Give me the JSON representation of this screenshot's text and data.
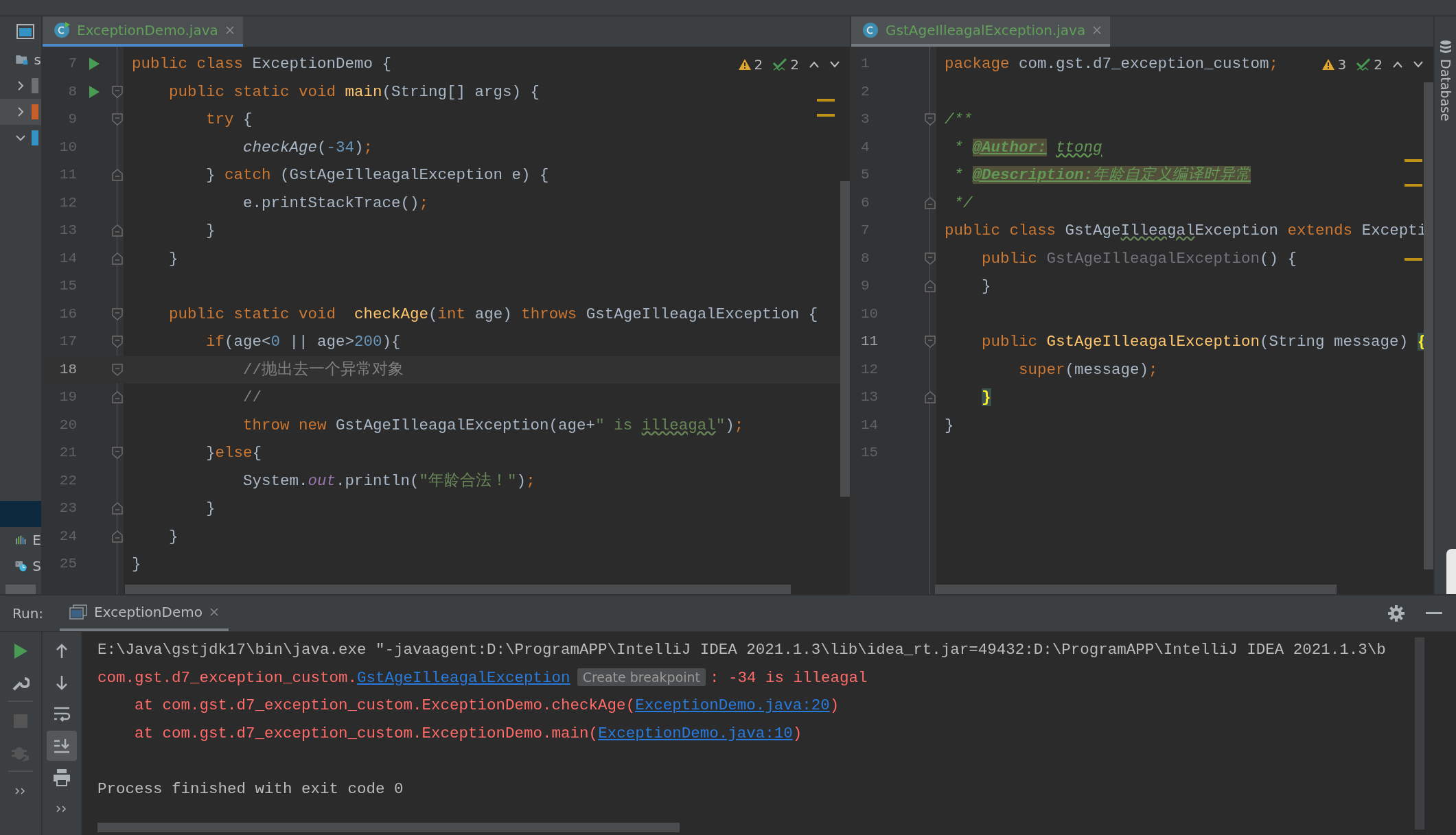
{
  "project_strip": {
    "items": [
      {
        "kind": "folder",
        "label": "s",
        "selected": false
      },
      {
        "kind": "collapsed",
        "color": "#6e7174",
        "selected": false
      },
      {
        "kind": "collapsed",
        "color": "#c75f2b",
        "selected": true
      },
      {
        "kind": "expanded",
        "color": "#3592c4",
        "selected": false
      },
      {
        "kind": "blank",
        "selected": false
      },
      {
        "kind": "chart",
        "label": "E",
        "selected": false
      },
      {
        "kind": "services",
        "label": "S",
        "selected": false
      }
    ]
  },
  "left_editor": {
    "focused": true,
    "tab": {
      "label": "ExceptionDemo.java",
      "selected": true
    },
    "inspections": {
      "warnings": "2",
      "weak_warnings": "2"
    },
    "lines": [
      {
        "number": "7",
        "current": false,
        "run": true,
        "fold_marker": false,
        "tokens": [
          {
            "kind": "kw",
            "text": "public class "
          },
          {
            "kind": "pl",
            "text": "ExceptionDemo {"
          }
        ]
      },
      {
        "number": "8",
        "current": false,
        "run": true,
        "fold_marker": true,
        "fold_end": false,
        "tokens": [
          {
            "kind": "kw",
            "text": "    public static void "
          },
          {
            "kind": "decl",
            "text": "main"
          },
          {
            "kind": "pl",
            "text": "(String[] args) {"
          }
        ]
      },
      {
        "number": "9",
        "current": false,
        "run": false,
        "fold_marker": true,
        "fold_end": false,
        "tokens": [
          {
            "kind": "kw",
            "text": "        try "
          },
          {
            "kind": "pl",
            "text": "{"
          }
        ]
      },
      {
        "number": "10",
        "current": false,
        "run": false,
        "fold_marker": false,
        "tokens": [
          {
            "kind": "it",
            "text": "            checkAge"
          },
          {
            "kind": "pl",
            "text": "("
          },
          {
            "kind": "num",
            "text": "-34"
          },
          {
            "kind": "pl",
            "text": ")"
          },
          {
            "kind": "kw",
            "text": ";"
          }
        ]
      },
      {
        "number": "11",
        "current": false,
        "run": false,
        "fold_marker": true,
        "fold_end": true,
        "tokens": [
          {
            "kind": "pl",
            "text": "        } "
          },
          {
            "kind": "kw",
            "text": "catch "
          },
          {
            "kind": "pl",
            "text": "(GstAgeIlleagalException e) {"
          }
        ]
      },
      {
        "number": "12",
        "current": false,
        "run": false,
        "fold_marker": false,
        "tokens": [
          {
            "kind": "pl",
            "text": "            e.printStackTrace()"
          },
          {
            "kind": "kw",
            "text": ";"
          }
        ]
      },
      {
        "number": "13",
        "current": false,
        "run": false,
        "fold_marker": true,
        "fold_end": true,
        "tokens": [
          {
            "kind": "pl",
            "text": "        }"
          }
        ]
      },
      {
        "number": "14",
        "current": false,
        "run": false,
        "fold_marker": true,
        "fold_end": true,
        "tokens": [
          {
            "kind": "pl",
            "text": "    }"
          }
        ]
      },
      {
        "number": "15",
        "current": false,
        "run": false,
        "fold_marker": false
      },
      {
        "number": "16",
        "current": false,
        "run": false,
        "fold_marker": true,
        "fold_end": false,
        "tokens": [
          {
            "kind": "kw",
            "text": "    public static void  "
          },
          {
            "kind": "decl",
            "text": "checkAge"
          },
          {
            "kind": "pl",
            "text": "("
          },
          {
            "kind": "kw",
            "text": "int "
          },
          {
            "kind": "pl",
            "text": "age) "
          },
          {
            "kind": "kw",
            "text": "throws "
          },
          {
            "kind": "pl",
            "text": "GstAgeIlleagalException {"
          }
        ]
      },
      {
        "number": "17",
        "current": false,
        "run": false,
        "fold_marker": true,
        "fold_end": false,
        "tokens": [
          {
            "kind": "kw",
            "text": "        if"
          },
          {
            "kind": "pl",
            "text": "(age<"
          },
          {
            "kind": "num",
            "text": "0"
          },
          {
            "kind": "pl",
            "text": " || age>"
          },
          {
            "kind": "num",
            "text": "200"
          },
          {
            "kind": "pl",
            "text": "){"
          }
        ]
      },
      {
        "number": "18",
        "current": true,
        "run": false,
        "fold_marker": true,
        "fold_end": false,
        "tokens": [
          {
            "kind": "cm",
            "text": "            //抛出去一个异常对象"
          }
        ]
      },
      {
        "number": "19",
        "current": false,
        "run": false,
        "fold_marker": true,
        "fold_end": true,
        "tokens": [
          {
            "kind": "cm",
            "text": "            //"
          }
        ]
      },
      {
        "number": "20",
        "current": false,
        "run": false,
        "fold_marker": false,
        "tokens": [
          {
            "kind": "kw",
            "text": "            throw new "
          },
          {
            "kind": "pl",
            "text": "GstAgeIlleagalException(age+"
          },
          {
            "kind": "str",
            "text": "\" is "
          },
          {
            "kind": "strtypo",
            "text": "illeagal"
          },
          {
            "kind": "str",
            "text": "\""
          },
          {
            "kind": "pl",
            "text": ")"
          },
          {
            "kind": "kw",
            "text": ";"
          }
        ]
      },
      {
        "number": "21",
        "current": false,
        "run": false,
        "fold_marker": true,
        "fold_end": false,
        "tokens": [
          {
            "kind": "pl",
            "text": "        }"
          },
          {
            "kind": "kw",
            "text": "else"
          },
          {
            "kind": "pl",
            "text": "{"
          }
        ]
      },
      {
        "number": "22",
        "current": false,
        "run": false,
        "fold_marker": false,
        "tokens": [
          {
            "kind": "pl",
            "text": "            System."
          },
          {
            "kind": "field",
            "text": "out"
          },
          {
            "kind": "pl",
            "text": ".println("
          },
          {
            "kind": "str",
            "text": "\"年龄合法！\""
          },
          {
            "kind": "pl",
            "text": ")"
          },
          {
            "kind": "kw",
            "text": ";"
          }
        ]
      },
      {
        "number": "23",
        "current": false,
        "run": false,
        "fold_marker": true,
        "fold_end": true,
        "tokens": [
          {
            "kind": "pl",
            "text": "        }"
          }
        ]
      },
      {
        "number": "24",
        "current": false,
        "run": false,
        "fold_marker": true,
        "fold_end": true,
        "tokens": [
          {
            "kind": "pl",
            "text": "    }"
          }
        ]
      },
      {
        "number": "25",
        "current": false,
        "run": false,
        "fold_marker": false,
        "tokens": [
          {
            "kind": "pl",
            "text": "}"
          }
        ]
      }
    ]
  },
  "right_editor": {
    "focused": false,
    "tab": {
      "label": "GstAgeIlleagalException.java",
      "selected": true
    },
    "inspections": {
      "warnings": "3",
      "weak_warnings": "2"
    },
    "lines": [
      {
        "number": "1",
        "current": false,
        "fold_marker": false,
        "tokens": [
          {
            "kind": "kw",
            "text": "package "
          },
          {
            "kind": "pl",
            "text": "com.gst.d7_exception_custom"
          },
          {
            "kind": "kw",
            "text": ";"
          }
        ]
      },
      {
        "number": "2",
        "current": false,
        "fold_marker": false
      },
      {
        "number": "3",
        "current": false,
        "fold_marker": true,
        "fold_end": false,
        "tokens": [
          {
            "kind": "doc",
            "text": "/**"
          }
        ]
      },
      {
        "number": "4",
        "current": false,
        "fold_marker": false,
        "tokens": [
          {
            "kind": "doc",
            "text": " * "
          },
          {
            "kind": "tag",
            "text": "@Author:"
          },
          {
            "kind": "doctypo",
            "text": "ttong"
          }
        ]
      },
      {
        "number": "5",
        "current": false,
        "fold_marker": false,
        "tokens": [
          {
            "kind": "doc",
            "text": " * "
          },
          {
            "kind": "tag",
            "text": "@Description:"
          },
          {
            "kind": "tagtext",
            "text": "年龄自定义编译时异常"
          }
        ]
      },
      {
        "number": "6",
        "current": false,
        "fold_marker": true,
        "fold_end": true,
        "tokens": [
          {
            "kind": "doc",
            "text": " */"
          }
        ]
      },
      {
        "number": "7",
        "current": false,
        "fold_marker": false,
        "tokens": [
          {
            "kind": "kw",
            "text": "public class "
          },
          {
            "kind": "pl",
            "text": "GstAge"
          },
          {
            "kind": "typo",
            "text": "Illeagal"
          },
          {
            "kind": "pl",
            "text": "Exception "
          },
          {
            "kind": "kw",
            "text": "extends "
          },
          {
            "kind": "pl",
            "text": "Excepti"
          }
        ]
      },
      {
        "number": "8",
        "current": false,
        "fold_marker": true,
        "fold_end": false,
        "tokens": [
          {
            "kind": "kw",
            "text": "    public "
          },
          {
            "kind": "unused",
            "text": "GstAgeIlleagalException"
          },
          {
            "kind": "pl",
            "text": "() {"
          }
        ]
      },
      {
        "number": "9",
        "current": false,
        "fold_marker": true,
        "fold_end": true,
        "tokens": [
          {
            "kind": "pl",
            "text": "    }"
          }
        ]
      },
      {
        "number": "10",
        "current": false,
        "fold_marker": false
      },
      {
        "number": "11",
        "current": true,
        "fold_marker": true,
        "fold_end": false,
        "tokens": [
          {
            "kind": "kw",
            "text": "    public "
          },
          {
            "kind": "decl",
            "text": "GstAgeIlleagalException"
          },
          {
            "kind": "pl",
            "text": "(String message) "
          },
          {
            "kind": "match",
            "text": "{"
          }
        ]
      },
      {
        "number": "12",
        "current": false,
        "fold_marker": false,
        "tokens": [
          {
            "kind": "kw",
            "text": "        super"
          },
          {
            "kind": "pl",
            "text": "(message)"
          },
          {
            "kind": "kw",
            "text": ";"
          }
        ]
      },
      {
        "number": "13",
        "current": false,
        "fold_marker": true,
        "fold_end": true,
        "tokens": [
          {
            "kind": "match",
            "text": "    }"
          }
        ]
      },
      {
        "number": "14",
        "current": false,
        "fold_marker": false,
        "tokens": [
          {
            "kind": "pl",
            "text": "}"
          }
        ]
      },
      {
        "number": "15",
        "current": false,
        "fold_marker": false
      }
    ]
  },
  "side_strip": {
    "label": "Database"
  },
  "run_panel": {
    "label": "Run:",
    "tab": {
      "label": "ExceptionDemo",
      "selected": true
    },
    "left_toolbar": [
      {
        "kind": "run",
        "disabled": false
      },
      {
        "kind": "wrench",
        "disabled": false
      },
      {
        "kind": "stop",
        "disabled": true
      },
      {
        "kind": "debug",
        "disabled": true
      },
      {
        "kind": "more",
        "disabled": false
      }
    ],
    "right_toolbar": [
      {
        "kind": "up",
        "selected": false
      },
      {
        "kind": "down",
        "selected": false
      },
      {
        "kind": "wrap",
        "selected": false
      },
      {
        "kind": "scroll_end",
        "selected": true
      },
      {
        "kind": "print",
        "selected": false
      },
      {
        "kind": "more",
        "selected": false
      }
    ],
    "console": [
      {
        "gap_before": false,
        "tokens": [
          {
            "kind": "pl",
            "text": "E:\\Java\\gstjdk17\\bin\\java.exe \"-javaagent:D:\\ProgramAPP\\IntelliJ IDEA 2021.1.3\\lib\\idea_rt.jar=49432:D:\\ProgramAPP\\IntelliJ IDEA 2021.1.3\\b"
          }
        ]
      },
      {
        "gap_before": false,
        "tokens": [
          {
            "kind": "err",
            "text": "com.gst.d7_exception_custom."
          },
          {
            "kind": "link",
            "text": "GstAgeIlleagalException"
          },
          {
            "kind": "tip",
            "text": "Create breakpoint"
          },
          {
            "kind": "err",
            "text": ": -34 is illeagal"
          }
        ]
      },
      {
        "gap_before": false,
        "tokens": [
          {
            "kind": "err",
            "text": "    at com.gst.d7_exception_custom.ExceptionDemo.checkAge("
          },
          {
            "kind": "link",
            "text": "ExceptionDemo.java:20"
          },
          {
            "kind": "err",
            "text": ")"
          }
        ]
      },
      {
        "gap_before": false,
        "tokens": [
          {
            "kind": "err",
            "text": "    at com.gst.d7_exception_custom.ExceptionDemo.main("
          },
          {
            "kind": "link",
            "text": "ExceptionDemo.java:10"
          },
          {
            "kind": "err",
            "text": ")"
          }
        ]
      },
      {
        "gap_before": true,
        "tokens": [
          {
            "kind": "pl",
            "text": "Process finished with exit code 0"
          }
        ]
      }
    ]
  }
}
